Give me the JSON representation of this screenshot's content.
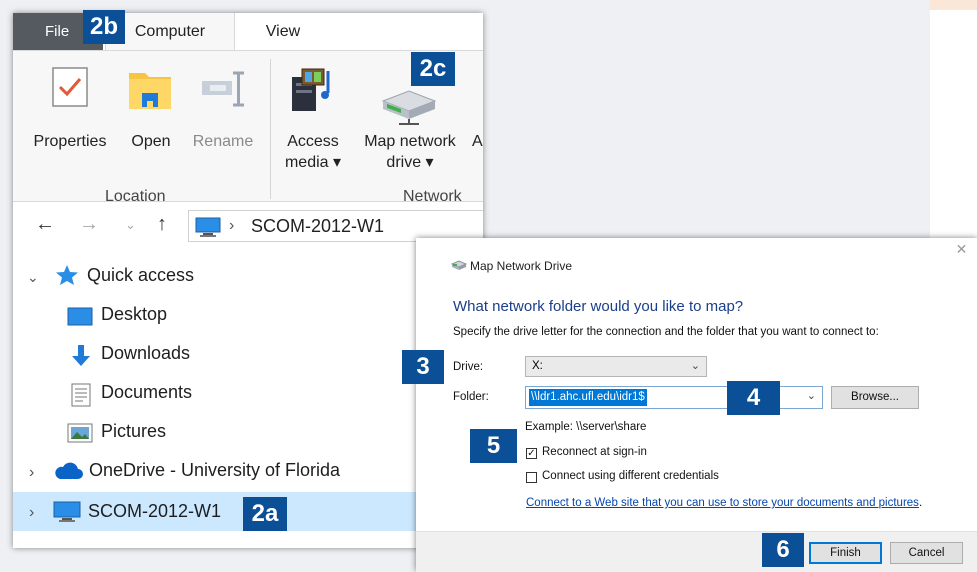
{
  "ribbon": {
    "tabs": {
      "file": "File",
      "computer": "Computer",
      "view": "View"
    },
    "location": {
      "group_label": "Location",
      "properties": "Properties",
      "open": "Open",
      "rename": "Rename"
    },
    "network": {
      "group_label": "Network",
      "access_media_l1": "Access",
      "access_media_l2": "media ▾",
      "map_drive_l1": "Map network",
      "map_drive_l2": "drive ▾",
      "cut_letter": "A"
    }
  },
  "address_bar": {
    "separator": "›",
    "location": "SCOM-2012-W1"
  },
  "nav_pane": {
    "quick_access": "Quick access",
    "desktop": "Desktop",
    "downloads": "Downloads",
    "documents": "Documents",
    "pictures": "Pictures",
    "onedrive": "OneDrive - University of Florida",
    "computer": "SCOM-2012-W1"
  },
  "dialog": {
    "title": "Map Network Drive",
    "heading": "What network folder would you like to map?",
    "instruction": "Specify the drive letter for the connection and the folder that you want to connect to:",
    "drive_label": "Drive:",
    "drive_value": "X:",
    "folder_label": "Folder:",
    "folder_value": "\\\\ldr1.ahc.ufl.edu\\idr1$",
    "browse": "Browse...",
    "example": "Example: \\\\server\\share",
    "reconnect_label": "Reconnect at sign-in",
    "reconnect_checked": true,
    "credentials_label": "Connect using different credentials",
    "credentials_checked": false,
    "link": "Connect to a Web site that you can use to store your documents and pictures",
    "link_suffix": ".",
    "finish": "Finish",
    "cancel": "Cancel",
    "close_glyph": "✕"
  },
  "badges": {
    "b2a": "2a",
    "b2b": "2b",
    "b2c": "2c",
    "b3": "3",
    "b4": "4",
    "b5": "5",
    "b6": "6"
  },
  "colors": {
    "badge": "#0b4f96",
    "selection": "#cce8ff",
    "link": "#0645ad",
    "heading": "#1a3e8a"
  }
}
